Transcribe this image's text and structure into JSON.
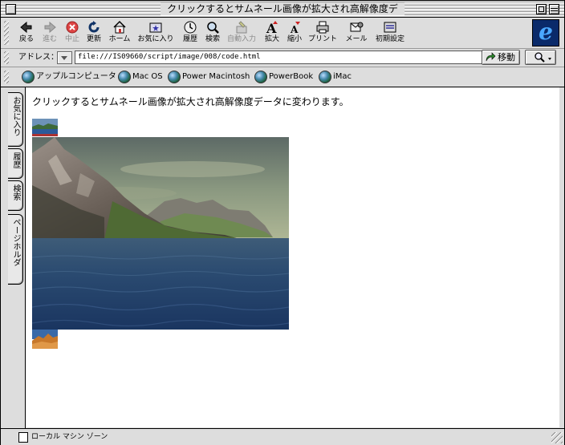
{
  "window": {
    "title": "クリックするとサムネール画像が拡大され高解像度デ"
  },
  "toolbar": {
    "back": "戻る",
    "forward": "進む",
    "stop": "中止",
    "refresh": "更新",
    "home": "ホーム",
    "favorites": "お気に入り",
    "history": "履歴",
    "search": "検索",
    "autofill": "自動入力",
    "larger": "拡大",
    "smaller": "縮小",
    "print": "プリント",
    "mail": "メール",
    "preferences": "初期設定"
  },
  "address": {
    "label": "アドレス：",
    "url": "file:///IS09660/script/image/008/code.html",
    "go_label": "移動"
  },
  "favorites_bar": {
    "items": [
      {
        "label": "アップルコンピュータ"
      },
      {
        "label": "Mac OS"
      },
      {
        "label": "Power Macintosh"
      },
      {
        "label": "PowerBook"
      },
      {
        "label": "iMac"
      }
    ]
  },
  "side_tabs": {
    "favorites": "お気に入り",
    "history": "履歴",
    "search": "検索",
    "page_holder": "ページホルダ"
  },
  "content": {
    "intro": "クリックするとサムネール画像が拡大され高解像度データに変わります。"
  },
  "status": {
    "zone": "ローカル マシン ゾーン"
  },
  "colors": {
    "chrome": "#dddddd",
    "content_bg": "#ffffff",
    "ie_blue": "#4aa8ff"
  }
}
